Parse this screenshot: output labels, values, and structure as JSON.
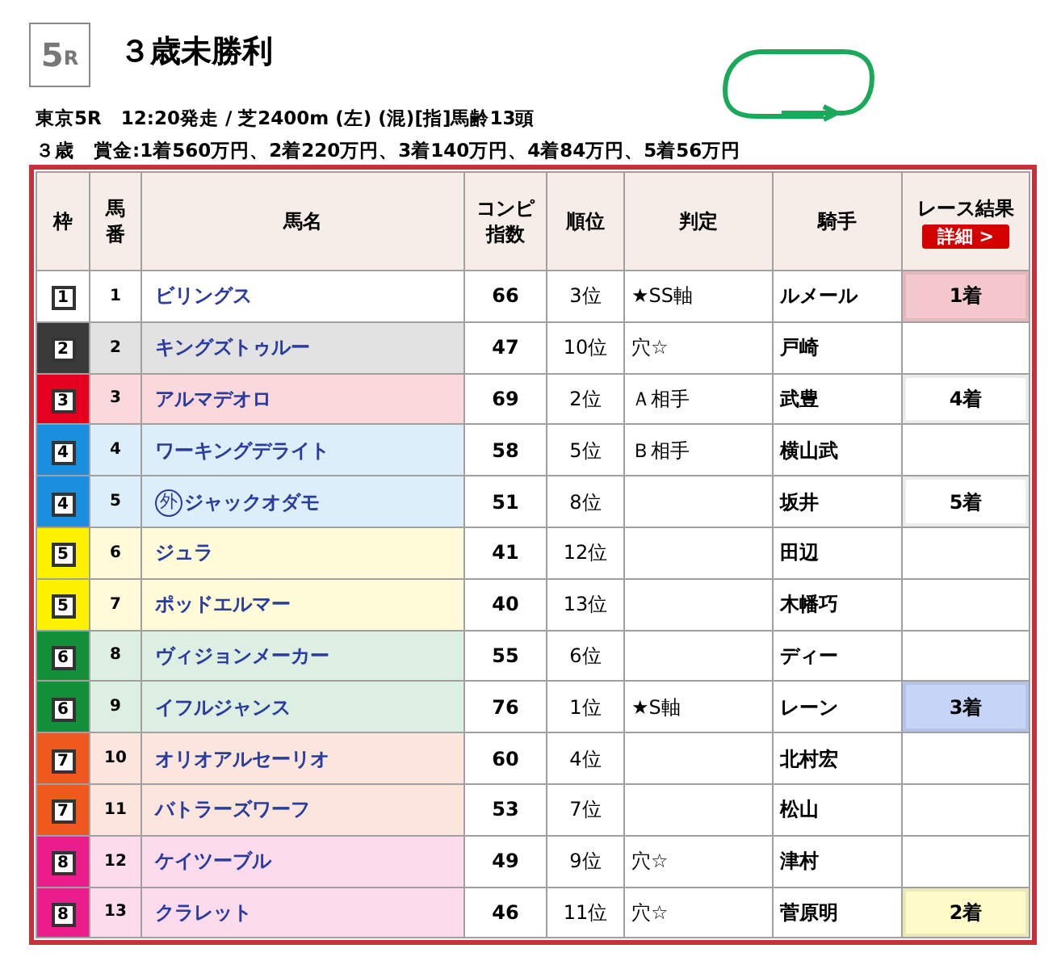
{
  "race": {
    "number": "5",
    "suffix": "R",
    "title": "３歳未勝利",
    "info": "東京5R　12:20発走 / 芝2400m (左) (混)[指]馬齢13頭",
    "prize": "３歳　賞金:1着560万円、2着220万円、3着140万円、4着84万円、5着56万円"
  },
  "table": {
    "columns": [
      "枠",
      "馬番",
      "馬名",
      "コンピ指数",
      "順位",
      "判定",
      "騎手",
      "レース結果"
    ],
    "detail_button": "詳細 >",
    "rows": [
      {
        "frame": {
          "number": "1",
          "color": "#ffffff"
        },
        "color": "#ffffff",
        "number": "1",
        "name": "ビリングス",
        "index": "66",
        "rank": "3位",
        "judgement": "★SS軸",
        "jockey": "ルメール",
        "result": {
          "text": "1着",
          "color": "#f5c8cd"
        }
      },
      {
        "frame": {
          "number": "2",
          "color": "#3a3a3a"
        },
        "color": "#e2e2e2",
        "number": "2",
        "name": "キングズトゥルー",
        "index": "47",
        "rank": "10位",
        "judgement": "穴☆",
        "jockey": "戸崎"
      },
      {
        "frame": {
          "number": "3",
          "color": "#e60020"
        },
        "color": "#fbd8dc",
        "number": "3",
        "name": "アルマデオロ",
        "index": "69",
        "rank": "2位",
        "judgement": "Ａ相手",
        "jockey": "武豊",
        "result": {
          "text": "4着",
          "color": "#ffffff"
        }
      },
      {
        "frame": {
          "number": "4",
          "color": "#1a8fe0"
        },
        "color": "#dbeefa",
        "number": "4",
        "name": "ワーキングデライト",
        "index": "58",
        "rank": "5位",
        "judgement": "Ｂ相手",
        "jockey": "横山武"
      },
      {
        "frame": {
          "number": "4",
          "color": "#1a8fe0"
        },
        "color": "#dbeefa",
        "number": "5",
        "mark": "外",
        "name": "ジャックオダモ",
        "index": "51",
        "rank": "8位",
        "jockey": "坂井",
        "result": {
          "text": "5着",
          "color": "#ffffff"
        }
      },
      {
        "frame": {
          "number": "5",
          "color": "#fff200"
        },
        "color": "#fffbd8",
        "number": "6",
        "name": "ジュラ",
        "index": "41",
        "rank": "12位",
        "jockey": "田辺"
      },
      {
        "frame": {
          "number": "5",
          "color": "#fff200"
        },
        "color": "#fffbd8",
        "number": "7",
        "name": "ポッドエルマー",
        "index": "40",
        "rank": "13位",
        "jockey": "木幡巧"
      },
      {
        "frame": {
          "number": "6",
          "color": "#149138"
        },
        "color": "#dcefe2",
        "number": "8",
        "name": "ヴィジョンメーカー",
        "index": "55",
        "rank": "6位",
        "jockey": "ディー"
      },
      {
        "frame": {
          "number": "6",
          "color": "#149138"
        },
        "color": "#dcefe2",
        "number": "9",
        "name": "イフルジャンス",
        "index": "76",
        "rank": "1位",
        "judgement": "★S軸",
        "jockey": "レーン",
        "result": {
          "text": "3着",
          "color": "#c6d4f8"
        }
      },
      {
        "frame": {
          "number": "7",
          "color": "#f0591d"
        },
        "color": "#fbe5dc",
        "number": "10",
        "name": "オリオアルセーリオ",
        "index": "60",
        "rank": "4位",
        "jockey": "北村宏"
      },
      {
        "frame": {
          "number": "7",
          "color": "#f0591d"
        },
        "color": "#fbe5dc",
        "number": "11",
        "name": "バトラーズワーフ",
        "index": "53",
        "rank": "7位",
        "jockey": "松山"
      },
      {
        "frame": {
          "number": "8",
          "color": "#ec1c8c"
        },
        "color": "#fcdcec",
        "number": "12",
        "name": "ケイツーブル",
        "index": "49",
        "rank": "9位",
        "judgement": "穴☆",
        "jockey": "津村"
      },
      {
        "frame": {
          "number": "8",
          "color": "#ec1c8c"
        },
        "color": "#fcdcec",
        "number": "13",
        "name": "クラレット",
        "index": "46",
        "rank": "11位",
        "judgement": "穴☆",
        "jockey": "菅原明",
        "result": {
          "text": "2着",
          "color": "#fefbc8"
        }
      }
    ]
  }
}
